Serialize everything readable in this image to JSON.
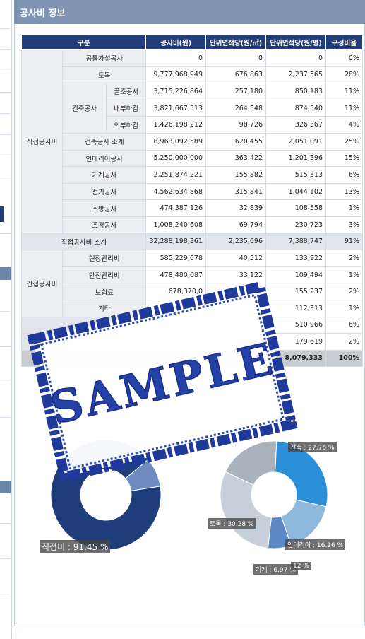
{
  "header": {
    "title": "공사비 정보"
  },
  "table": {
    "columns": [
      "구분",
      "공사비(원)",
      "단위면적당(원/㎡)",
      "단위면적당(원/평)",
      "구성비율"
    ],
    "groups": {
      "direct": "직접공사비",
      "indirect": "간접공사비",
      "building": "건축공사"
    },
    "rows": [
      {
        "label": "공통가설공사",
        "cost": "0",
        "sqm": "0",
        "pyeong": "0",
        "ratio": "0%"
      },
      {
        "label": "토목",
        "cost": "9,777,968,949",
        "sqm": "676,863",
        "pyeong": "2,237,565",
        "ratio": "28%"
      },
      {
        "label": "골조공사",
        "cost": "3,715,226,864",
        "sqm": "257,180",
        "pyeong": "850,183",
        "ratio": "11%"
      },
      {
        "label": "내부마감",
        "cost": "3,821,667,513",
        "sqm": "264,548",
        "pyeong": "874,540",
        "ratio": "11%"
      },
      {
        "label": "외부마감",
        "cost": "1,426,198,212",
        "sqm": "98,726",
        "pyeong": "326,367",
        "ratio": "4%"
      },
      {
        "label": "건축공사 소계",
        "cost": "8,963,092,589",
        "sqm": "620,455",
        "pyeong": "2,051,091",
        "ratio": "25%"
      },
      {
        "label": "인테리어공사",
        "cost": "5,250,000,000",
        "sqm": "363,422",
        "pyeong": "1,201,396",
        "ratio": "15%"
      },
      {
        "label": "기계공사",
        "cost": "2,251,874,221",
        "sqm": "155,882",
        "pyeong": "515,313",
        "ratio": "6%"
      },
      {
        "label": "전기공사",
        "cost": "4,562,634,868",
        "sqm": "315,841",
        "pyeong": "1,044,102",
        "ratio": "13%"
      },
      {
        "label": "소방공사",
        "cost": "474,387,126",
        "sqm": "32,839",
        "pyeong": "108,558",
        "ratio": "1%"
      },
      {
        "label": "조경공사",
        "cost": "1,008,240,608",
        "sqm": "69,794",
        "pyeong": "230,723",
        "ratio": "3%"
      },
      {
        "label": "직접공사비 소계",
        "cost": "32,288,198,361",
        "sqm": "2,235,096",
        "pyeong": "7,388,747",
        "ratio": "91%"
      },
      {
        "label": "현장관리비",
        "cost": "585,229,678",
        "sqm": "40,512",
        "pyeong": "133,922",
        "ratio": "2%"
      },
      {
        "label": "안전관리비",
        "cost": "478,480,087",
        "sqm": "33,122",
        "pyeong": "109,494",
        "ratio": "1%"
      },
      {
        "label": "보험료",
        "cost": "678,370,0",
        "sqm": "",
        "pyeong": "155,237",
        "ratio": "2%"
      },
      {
        "label": "기타",
        "cost": "",
        "sqm": "",
        "pyeong": "112,313",
        "ratio": "1%"
      },
      {
        "label": "",
        "cost": "",
        "sqm": "",
        "pyeong": "510,966",
        "ratio": "6%"
      },
      {
        "label": "",
        "cost": "",
        "sqm": "",
        "pyeong": "179,619",
        "ratio": "2%"
      },
      {
        "label": "",
        "cost": "",
        "sqm": "8",
        "pyeong": "8,079,333",
        "ratio": "100%"
      }
    ]
  },
  "chart_data": [
    {
      "type": "pie",
      "labels": [
        "직접비"
      ],
      "values": [
        91.45
      ],
      "annotations": [
        "직접비 : 91.45 %"
      ]
    },
    {
      "type": "pie",
      "labels": [
        "건축",
        "인테리어",
        "기계",
        "토목"
      ],
      "values": [
        27.76,
        16.26,
        6.97,
        30.28
      ],
      "annotations": [
        "건축 : 27.76 %",
        "인테리어 : 16.26 %",
        "기계 : 6.97 %",
        "토목 : 30.28 %",
        "7 %",
        "12 %"
      ]
    }
  ],
  "stamp": {
    "text": "SAMPLE"
  },
  "colors": {
    "header": "#7f95b3",
    "table_head": "#233e78",
    "chart_dark": "#1f3d7a",
    "chart_blue": "#2a8ed8"
  }
}
